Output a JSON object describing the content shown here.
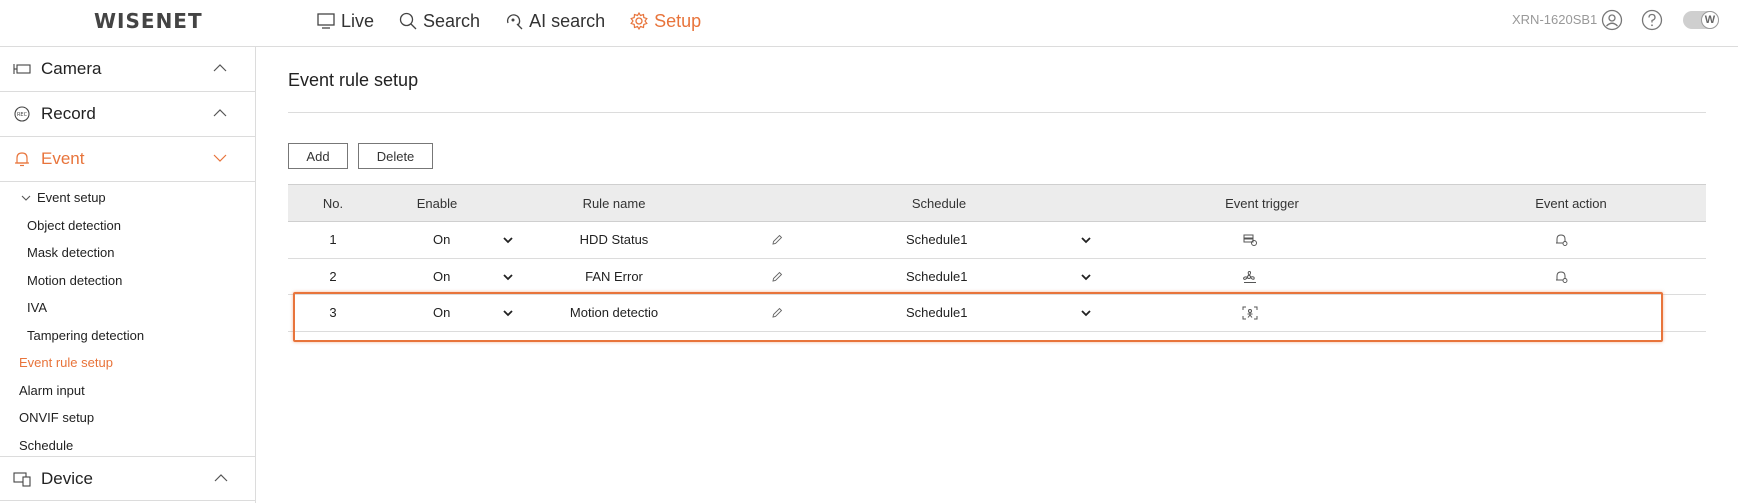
{
  "header": {
    "logo": "WISENET",
    "nav": [
      {
        "label": "Live",
        "icon": "monitor-icon"
      },
      {
        "label": "Search",
        "icon": "search-icon"
      },
      {
        "label": "AI search",
        "icon": "ai-search-icon"
      },
      {
        "label": "Setup",
        "icon": "gear-icon",
        "active": true
      }
    ],
    "model": "XRN-1620SB1",
    "toggle_letter": "W"
  },
  "sidebar": {
    "categories": {
      "camera": "Camera",
      "record": "Record",
      "event": "Event",
      "device": "Device"
    },
    "event_items": {
      "event_setup": "Event setup",
      "object_detection": "Object detection",
      "mask_detection": "Mask detection",
      "motion_detection": "Motion detection",
      "iva": "IVA",
      "tampering_detection": "Tampering detection",
      "event_rule_setup": "Event rule setup",
      "alarm_input": "Alarm input",
      "onvif_setup": "ONVIF setup",
      "schedule": "Schedule"
    }
  },
  "main": {
    "title": "Event rule setup",
    "add_label": "Add",
    "delete_label": "Delete",
    "table": {
      "headers": {
        "no": "No.",
        "enable": "Enable",
        "rule_name": "Rule name",
        "schedule": "Schedule",
        "event_trigger": "Event trigger",
        "event_action": "Event action"
      },
      "rows": [
        {
          "no": "1",
          "enable": "On",
          "rule_name": "HDD Status",
          "schedule": "Schedule1",
          "trigger_icon": "hdd-icon",
          "action_icon": "bell-icon"
        },
        {
          "no": "2",
          "enable": "On",
          "rule_name": "FAN Error",
          "schedule": "Schedule1",
          "trigger_icon": "fan-icon",
          "action_icon": "bell-icon"
        },
        {
          "no": "3",
          "enable": "On",
          "rule_name": "Motion detectio",
          "schedule": "Schedule1",
          "trigger_icon": "motion-icon",
          "action_icon": ""
        }
      ]
    }
  },
  "colors": {
    "accent": "#e8743b",
    "header_bg": "#ececec",
    "border": "#dcdcdc"
  }
}
